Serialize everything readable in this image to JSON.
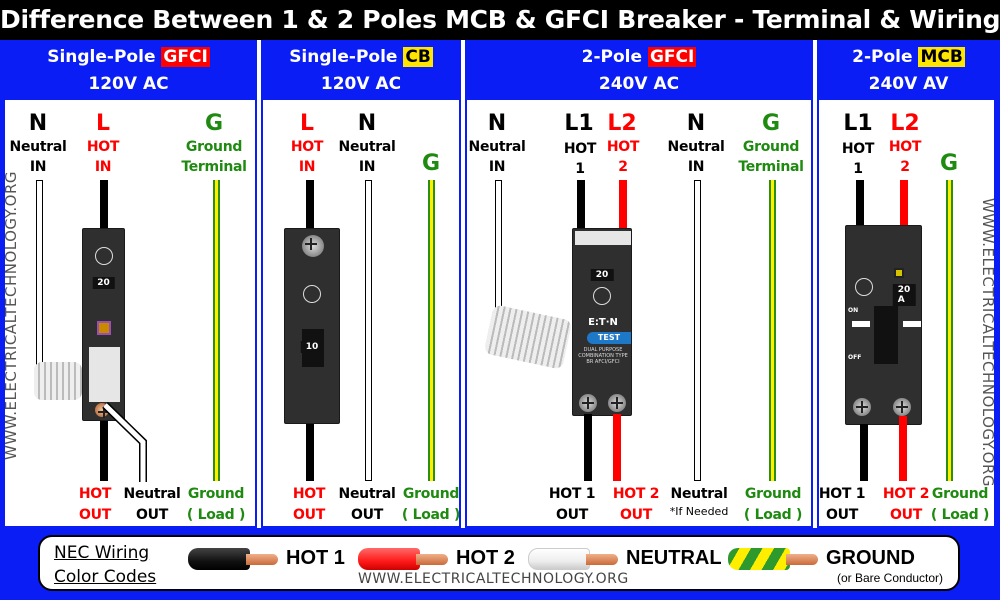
{
  "title": "Difference Between 1 & 2 Poles MCB & GFCI Breaker - Terminal & Wiring",
  "panels": [
    {
      "id": "single-pole-gfci",
      "heading_prefix": "Single-Pole",
      "heading_tag": "GFCI",
      "voltage": "120V AC",
      "terminals_top": [
        {
          "letter": "N",
          "line1": "Neutral",
          "line2": "IN",
          "color": "black"
        },
        {
          "letter": "L",
          "line1": "HOT",
          "line2": "IN",
          "color": "red"
        },
        {
          "letter": "G",
          "line1": "Ground",
          "line2": "Terminal",
          "color": "green"
        }
      ],
      "terminals_bottom": [
        {
          "line1": "HOT",
          "line2": "OUT",
          "color": "red"
        },
        {
          "line1": "Neutral",
          "line2": "OUT",
          "color": "black"
        },
        {
          "line1": "Ground",
          "line2": "( Load )",
          "color": "green"
        }
      ],
      "breaker_rating": "20"
    },
    {
      "id": "single-pole-cb",
      "heading_prefix": "Single-Pole",
      "heading_tag": "CB",
      "voltage": "120V AC",
      "terminals_top": [
        {
          "letter": "L",
          "line1": "HOT",
          "line2": "IN",
          "color": "red"
        },
        {
          "letter": "N",
          "line1": "Neutral",
          "line2": "IN",
          "color": "black"
        },
        {
          "letter": "G",
          "color": "green"
        }
      ],
      "terminals_bottom": [
        {
          "line1": "HOT",
          "line2": "OUT",
          "color": "red"
        },
        {
          "line1": "Neutral",
          "line2": "OUT",
          "color": "black"
        },
        {
          "line1": "Ground",
          "line2": "( Load )",
          "color": "green"
        }
      ],
      "breaker_rating": "10"
    },
    {
      "id": "two-pole-gfci",
      "heading_prefix": "2-Pole",
      "heading_tag": "GFCI",
      "voltage": "240V AC",
      "terminals_top": [
        {
          "letter": "N",
          "line1": "Neutral",
          "line2": "IN",
          "color": "black"
        },
        {
          "letter": "L1",
          "line1": "HOT",
          "line2": "1",
          "color": "black"
        },
        {
          "letter": "L2",
          "line1": "HOT",
          "line2": "2",
          "color": "red"
        },
        {
          "letter": "N",
          "line1": "Neutral",
          "line2": "IN",
          "color": "black"
        },
        {
          "letter": "G",
          "line1": "Ground",
          "line2": "Terminal",
          "color": "green"
        }
      ],
      "terminals_bottom": [
        {
          "line1": "HOT 1",
          "line2": "OUT",
          "color": "black"
        },
        {
          "line1": "HOT 2",
          "line2": "OUT",
          "color": "red"
        },
        {
          "line1": "Neutral",
          "line2": "*If Needed",
          "color": "black"
        },
        {
          "line1": "Ground",
          "line2": "( Load )",
          "color": "green"
        }
      ],
      "breaker_rating": "20",
      "breaker_brand": "E:T·N",
      "breaker_button": "TEST",
      "breaker_text": "DUAL PURPOSE COMBINATION TYPE BR AFCI/GFCI"
    },
    {
      "id": "two-pole-mcb",
      "heading_prefix": "2-Pole",
      "heading_tag": "MCB",
      "voltage": "240V AV",
      "terminals_top": [
        {
          "letter": "L1",
          "line1": "HOT",
          "line2": "1",
          "color": "black"
        },
        {
          "letter": "L2",
          "line1": "HOT",
          "line2": "2",
          "color": "red"
        },
        {
          "letter": "G",
          "color": "green"
        }
      ],
      "terminals_bottom": [
        {
          "line1": "HOT 1",
          "line2": "OUT",
          "color": "black"
        },
        {
          "line1": "HOT 2",
          "line2": "OUT",
          "color": "red"
        },
        {
          "line1": "Ground",
          "line2": "( Load )",
          "color": "green"
        }
      ],
      "breaker_rating": "20 A",
      "breaker_on": "ON",
      "breaker_off": "OFF"
    }
  ],
  "watermark": "WWW.ELECTRICALTECHNOLOGY.ORG",
  "legend": {
    "title_line1": "NEC Wiring",
    "title_line2": "Color Codes",
    "items": [
      {
        "label": "HOT 1",
        "color": "#111111"
      },
      {
        "label": "HOT 2",
        "color": "#ff1a1a"
      },
      {
        "label": "NEUTRAL",
        "color": "#f2f2f2"
      },
      {
        "label": "GROUND",
        "sublabel": "(or Bare Conductor)",
        "color": "green-yellow"
      }
    ],
    "url": "WWW.ELECTRICALTECHNOLOGY.ORG"
  },
  "colors": {
    "header_blue": "#0a1df5",
    "hot_red": "#ff0000",
    "ground_green": "#1e8a10",
    "tag_yellow": "#ffe600"
  }
}
